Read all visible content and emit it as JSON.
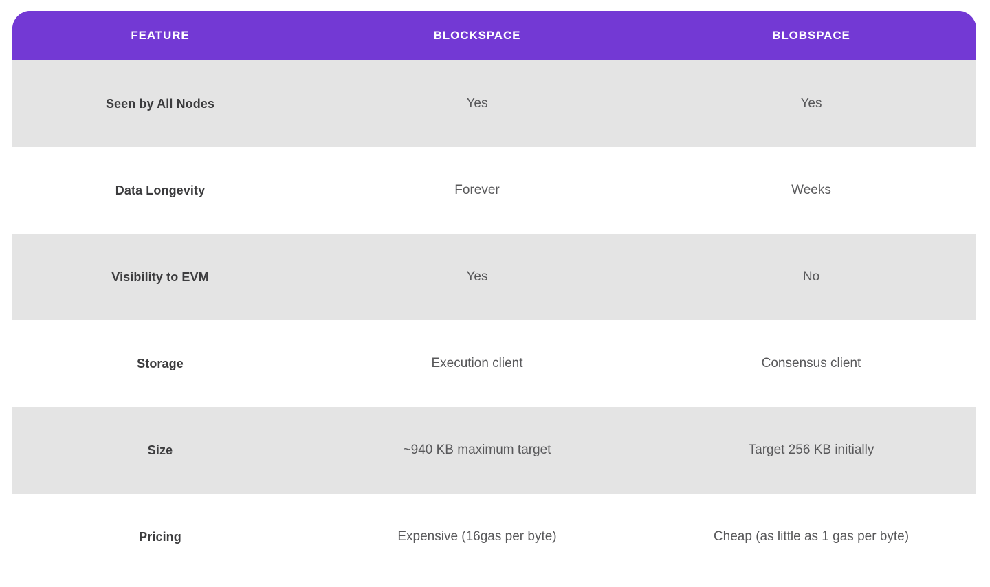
{
  "table": {
    "columns": [
      {
        "key": "feature",
        "label": "FEATURE"
      },
      {
        "key": "blockspace",
        "label": "BLOCKSPACE"
      },
      {
        "key": "blobspace",
        "label": "BLOBSPACE"
      }
    ],
    "rows": [
      {
        "feature": "Seen by All Nodes",
        "blockspace": "Yes",
        "blobspace": "Yes"
      },
      {
        "feature": "Data Longevity",
        "blockspace": "Forever",
        "blobspace": "Weeks"
      },
      {
        "feature": "Visibility to EVM",
        "blockspace": "Yes",
        "blobspace": "No"
      },
      {
        "feature": "Storage",
        "blockspace": "Execution client",
        "blobspace": "Consensus client"
      },
      {
        "feature": "Size",
        "blockspace": "~940 KB maximum target",
        "blobspace": "Target 256 KB initially"
      },
      {
        "feature": "Pricing",
        "blockspace": "Expensive (16gas per byte)",
        "blobspace": "Cheap (as little as 1 gas per byte)"
      }
    ]
  },
  "colors": {
    "header_background": "#7339D4",
    "header_text": "#FFFFFF",
    "row_shaded_background": "#E4E4E4",
    "row_plain_background": "#FFFFFF",
    "feature_text": "#3C3C3E",
    "value_text": "#58585A",
    "page_background": "#FFFFFF"
  }
}
